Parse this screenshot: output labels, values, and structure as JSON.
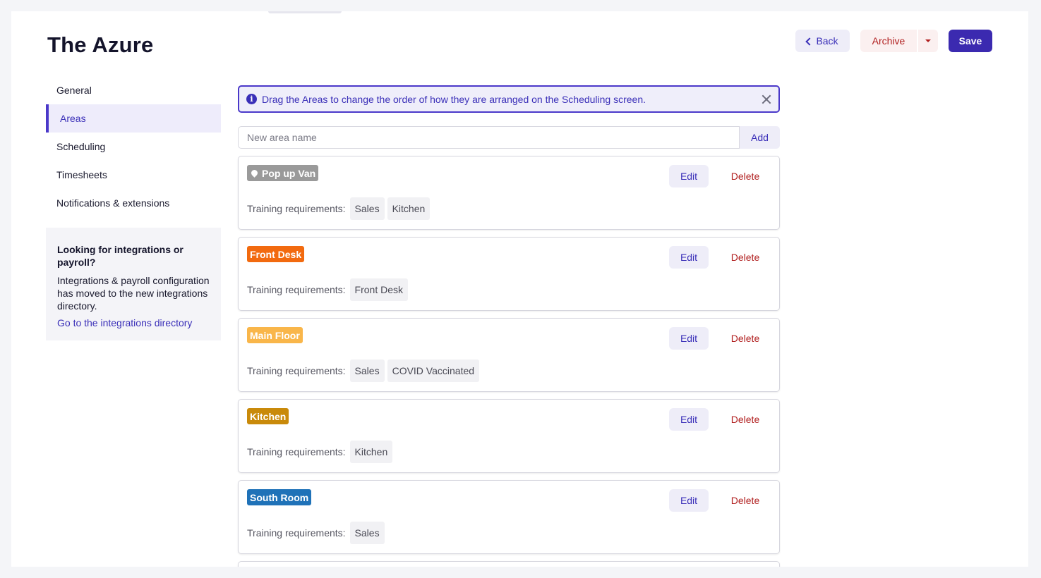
{
  "page": {
    "title": "The Azure"
  },
  "actions": {
    "back": "Back",
    "archive": "Archive",
    "save": "Save"
  },
  "sidenav": {
    "items": [
      {
        "label": "General",
        "active": false
      },
      {
        "label": "Areas",
        "active": true
      },
      {
        "label": "Scheduling",
        "active": false
      },
      {
        "label": "Timesheets",
        "active": false
      },
      {
        "label": "Notifications & extensions",
        "active": false
      }
    ],
    "info": {
      "title": "Looking for integrations or payroll?",
      "body": "Integrations & payroll configuration has moved to the new integrations directory.",
      "link": "Go to the integrations directory"
    }
  },
  "alert": {
    "message": "Drag the Areas to change the order of how they are arranged on the Scheduling screen."
  },
  "add_area": {
    "placeholder": "New area name",
    "button": "Add"
  },
  "area_labels": {
    "edit": "Edit",
    "delete": "Delete",
    "requirements": "Training requirements:"
  },
  "areas": [
    {
      "name": "Pop up Van",
      "color": "#9a9a9a",
      "pin_icon": true,
      "requirements": [
        "Sales",
        "Kitchen"
      ]
    },
    {
      "name": "Front Desk",
      "color": "#f26a0f",
      "pin_icon": false,
      "requirements": [
        "Front Desk"
      ]
    },
    {
      "name": "Main Floor",
      "color": "#f9b64a",
      "pin_icon": false,
      "requirements": [
        "Sales",
        "COVID Vaccinated"
      ]
    },
    {
      "name": "Kitchen",
      "color": "#c98a0a",
      "pin_icon": false,
      "requirements": [
        "Kitchen"
      ]
    },
    {
      "name": "South Room",
      "color": "#1f72b8",
      "pin_icon": false,
      "requirements": [
        "Sales"
      ]
    }
  ]
}
